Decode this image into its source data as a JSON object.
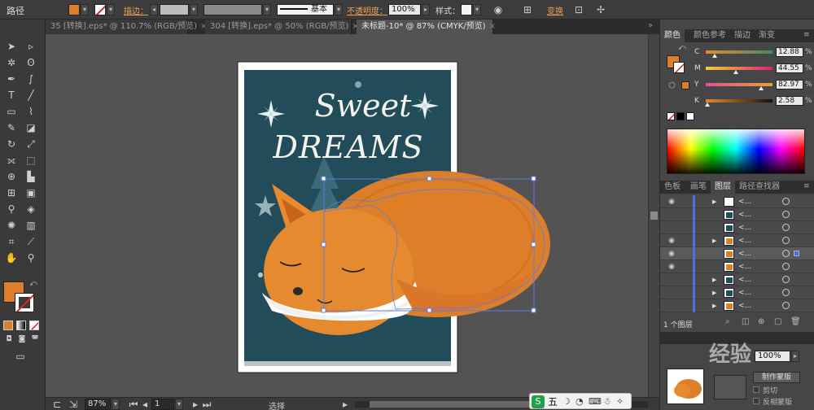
{
  "control_bar": {
    "title": "路径",
    "stroke_label": "描边：",
    "stroke_style": "基本",
    "opacity_label": "不透明度：",
    "opacity_value": "100%",
    "style_label": "样式：",
    "transform_label": "变换"
  },
  "tabs": [
    {
      "label": "35 [转换].eps* @ 110.7% (RGB/预览)",
      "active": false,
      "close": "×"
    },
    {
      "label": "304 [转换].eps* @ 50% (RGB/预览)",
      "active": false,
      "close": "×"
    },
    {
      "label": "未标题-10* @ 87% (CMYK/预览)",
      "active": true,
      "close": "×"
    }
  ],
  "artboard": {
    "heading_line1": "Sweet",
    "heading_line2": "DREAMS",
    "background_color": "#234c5a",
    "fox_orange": "#dd7f2a"
  },
  "status_bar": {
    "zoom": "87%",
    "page": "1",
    "selection_label": "选择"
  },
  "color_panel": {
    "tabs": [
      "颜色",
      "颜色参考",
      "描边",
      "渐变"
    ],
    "active_tab": "颜色",
    "fill_color": "#dd7f2a",
    "channels": [
      {
        "label": "C",
        "value": "12.88",
        "unit": "%",
        "level": 0.13
      },
      {
        "label": "M",
        "value": "44.55",
        "unit": "%",
        "level": 0.45
      },
      {
        "label": "Y",
        "value": "82.97",
        "unit": "%",
        "level": 0.83
      },
      {
        "label": "K",
        "value": "2.58",
        "unit": "%",
        "level": 0.03
      }
    ]
  },
  "layers_panel": {
    "tabs": [
      "色板",
      "画笔",
      "图层",
      "路径查找器"
    ],
    "active_tab": "图层",
    "row_name": "<...",
    "rows": [
      {
        "eye": true,
        "expand": true,
        "thumb": "white",
        "selected": false,
        "target": false
      },
      {
        "eye": false,
        "expand": false,
        "thumb": "teal",
        "selected": false,
        "target": false
      },
      {
        "eye": false,
        "expand": false,
        "thumb": "teal",
        "selected": false,
        "target": false
      },
      {
        "eye": true,
        "expand": true,
        "thumb": "orange",
        "selected": false,
        "target": false
      },
      {
        "eye": true,
        "expand": false,
        "thumb": "orange",
        "selected": true,
        "target": true
      },
      {
        "eye": true,
        "expand": false,
        "thumb": "orange",
        "selected": false,
        "target": false
      },
      {
        "eye": false,
        "expand": true,
        "thumb": "teal",
        "selected": false,
        "target": false
      },
      {
        "eye": false,
        "expand": true,
        "thumb": "teal",
        "selected": false,
        "target": false
      },
      {
        "eye": false,
        "expand": true,
        "thumb": "orange",
        "selected": false,
        "target": false
      }
    ],
    "footer_count": "1 个图层"
  },
  "transparency_panel": {
    "opacity": "100%",
    "make_mask_button": "制作蒙版",
    "clip_label": "剪切",
    "invert_mask_label": "反相蒙版"
  },
  "watermark_text": "经验",
  "ime_bar": {
    "label": "五"
  }
}
